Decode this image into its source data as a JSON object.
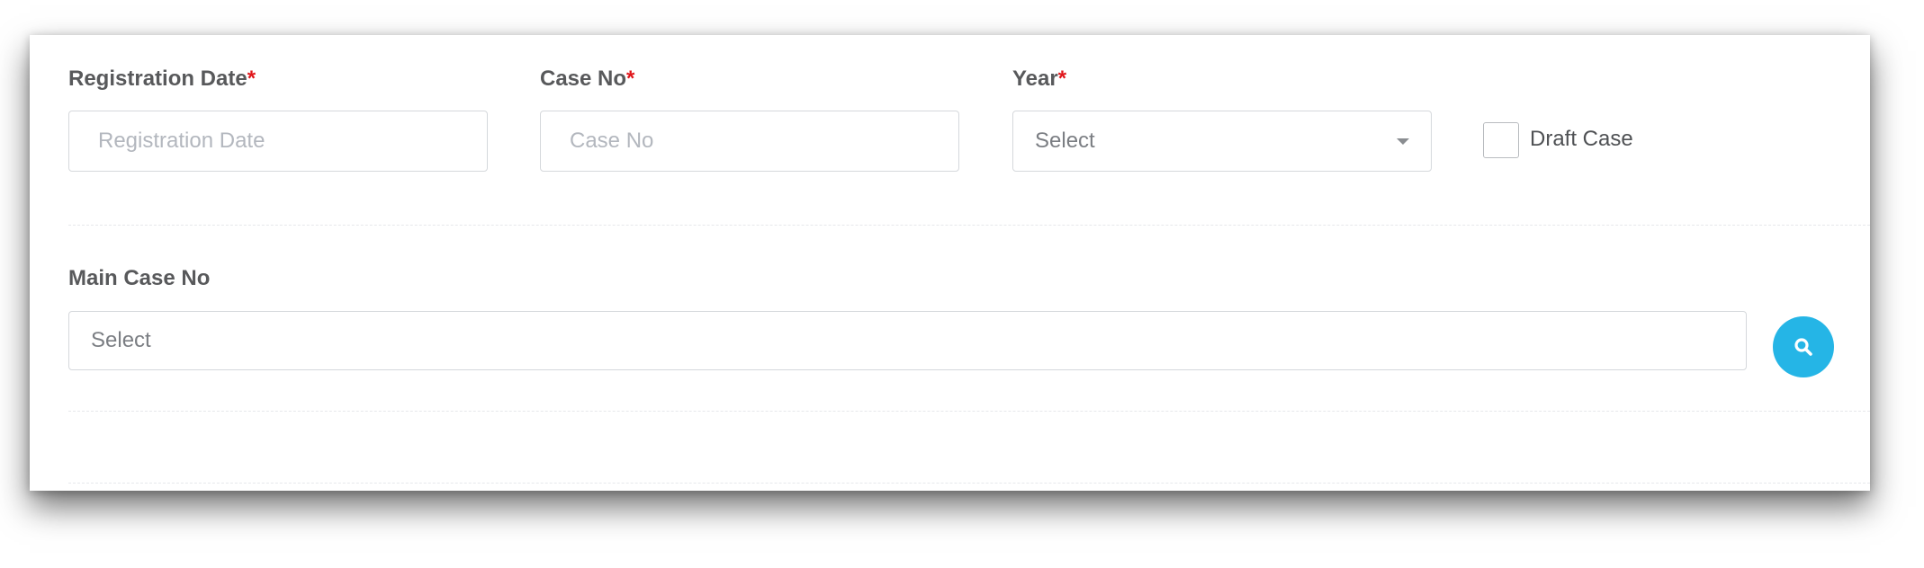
{
  "form": {
    "registration_date": {
      "label": "Registration Date",
      "required_mark": "*",
      "placeholder": "Registration Date"
    },
    "case_no": {
      "label": "Case No",
      "required_mark": "*",
      "placeholder": "Case No"
    },
    "year": {
      "label": "Year",
      "required_mark": "*",
      "selected": "Select"
    },
    "draft_case": {
      "label": "Draft Case",
      "checked": false
    },
    "main_case_no": {
      "label": "Main Case No",
      "selected": "Select"
    },
    "search_button": {
      "icon": "search-icon"
    }
  },
  "colors": {
    "accent": "#25b5e6",
    "required": "#e0151a"
  }
}
